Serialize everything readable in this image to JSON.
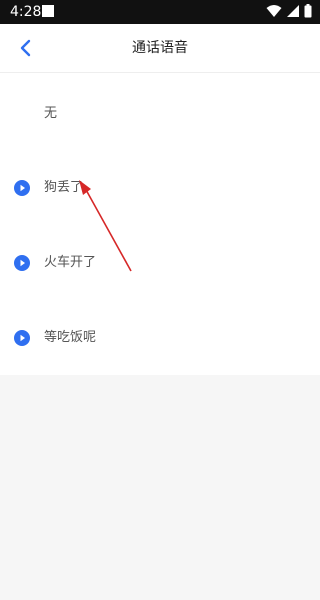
{
  "status_bar": {
    "time": "4:28",
    "icons": [
      "wifi-icon",
      "signal-icon",
      "battery-icon"
    ]
  },
  "header": {
    "title": "通话语音",
    "back_icon": "back-chevron-icon"
  },
  "options": [
    {
      "label": "无",
      "has_play": false
    },
    {
      "label": "狗丢了",
      "has_play": true
    },
    {
      "label": "火车开了",
      "has_play": true
    },
    {
      "label": "等吃饭呢",
      "has_play": true
    }
  ],
  "colors": {
    "accent": "#2f6ff0",
    "annotation": "#d62828"
  }
}
